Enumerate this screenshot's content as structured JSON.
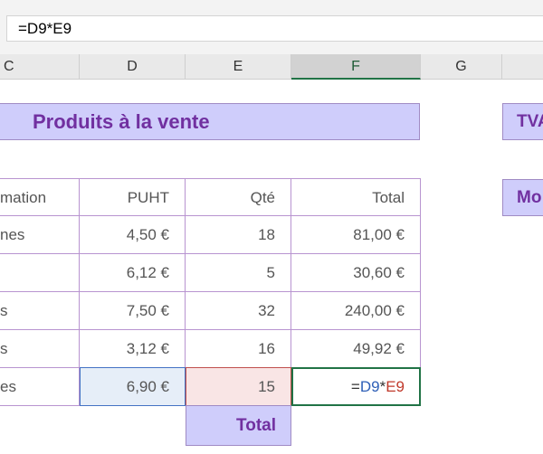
{
  "formula_bar": {
    "value": "=D9*E9"
  },
  "columns": [
    "C",
    "D",
    "E",
    "F",
    "G"
  ],
  "title": "Produits à la vente",
  "side_labels": [
    "TVA",
    "Mo"
  ],
  "table": {
    "headers": [
      "mation",
      "PUHT",
      "Qté",
      "Total"
    ],
    "rows": [
      {
        "designation": "nes",
        "puht": "4,50 €",
        "qte": "18",
        "total": "81,00 €"
      },
      {
        "designation": "",
        "puht": "6,12 €",
        "qte": "5",
        "total": "30,60 €"
      },
      {
        "designation": "s",
        "puht": "7,50 €",
        "qte": "32",
        "total": "240,00 €"
      },
      {
        "designation": "s",
        "puht": "3,12 €",
        "qte": "16",
        "total": "49,92 €"
      },
      {
        "designation": "es",
        "puht": "6,90 €",
        "qte": "15",
        "total": ""
      }
    ],
    "editing_formula": {
      "eq": "=",
      "ref1": "D9",
      "op": "*",
      "ref2": "E9"
    }
  },
  "total_label": "Total"
}
